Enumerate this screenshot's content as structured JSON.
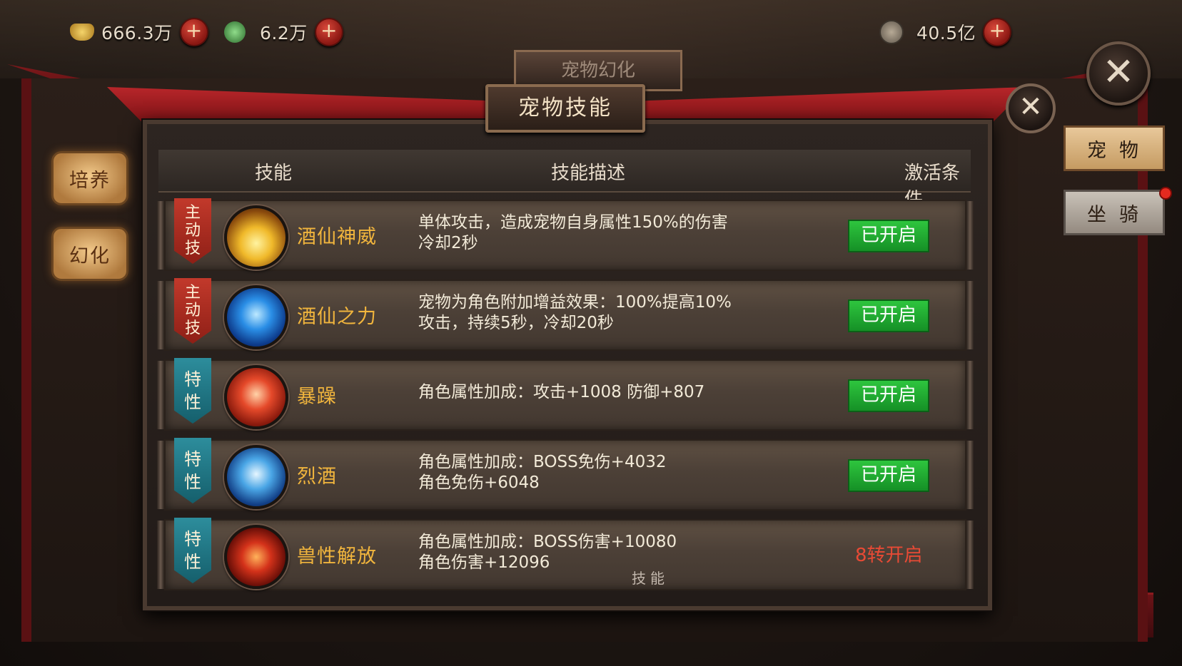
{
  "currencies": [
    {
      "icon": "gold-ingot-icon",
      "value": "666.3万"
    },
    {
      "icon": "jade-coin-icon",
      "value": "6.2万"
    },
    {
      "icon": "copper-coin-icon",
      "value": "40.5亿"
    }
  ],
  "background_title": "宠物幻化",
  "dialog": {
    "title": "宠物技能",
    "headers": {
      "skill": "技能",
      "description": "技能描述",
      "condition": "激活条件"
    }
  },
  "side_menu": {
    "cultivate": "培养",
    "transform": "幻化"
  },
  "right_tabs": {
    "pet": "宠物",
    "mount": "坐骑"
  },
  "skills": [
    {
      "type_label": "主\n动\n技",
      "type": "active",
      "icon": "golden-flame-icon",
      "name": "酒仙神威",
      "desc_line1": "单体攻击，造成宠物自身属性150%的伤害",
      "desc_line2": "冷却2秒",
      "status": "已开启",
      "active": true
    },
    {
      "type_label": "主\n动\n技",
      "type": "active",
      "icon": "blue-gourd-icon",
      "name": "酒仙之力",
      "desc_line1": "宠物为角色附加增益效果：100%提高10%",
      "desc_line2": "攻击，持续5秒，冷却20秒",
      "status": "已开启",
      "active": true
    },
    {
      "type_label": "特\n性",
      "type": "trait",
      "icon": "red-muscle-icon",
      "name": "暴躁",
      "desc_line1": "角色属性加成：攻击+1008 防御+807",
      "desc_line2": "",
      "status": "已开启",
      "active": true
    },
    {
      "type_label": "特\n性",
      "type": "trait",
      "icon": "blue-whirl-icon",
      "name": "烈酒",
      "desc_line1": "角色属性加成：BOSS免伤+4032",
      "desc_line2": "角色免伤+6048",
      "status": "已开启",
      "active": true
    },
    {
      "type_label": "特\n性",
      "type": "trait",
      "icon": "fire-vortex-icon",
      "name": "兽性解放",
      "desc_line1": "角色属性加成：BOSS伤害+10080",
      "desc_line2": "角色伤害+12096",
      "status": "8转开启",
      "active": false
    }
  ],
  "bottom_label": "技能",
  "colors": {
    "active_status": "#1fae33",
    "locked_status": "#e84a35",
    "skill_name": "#f1b53d",
    "accent_red": "#8e1f16",
    "trait_teal": "#1f7886"
  }
}
